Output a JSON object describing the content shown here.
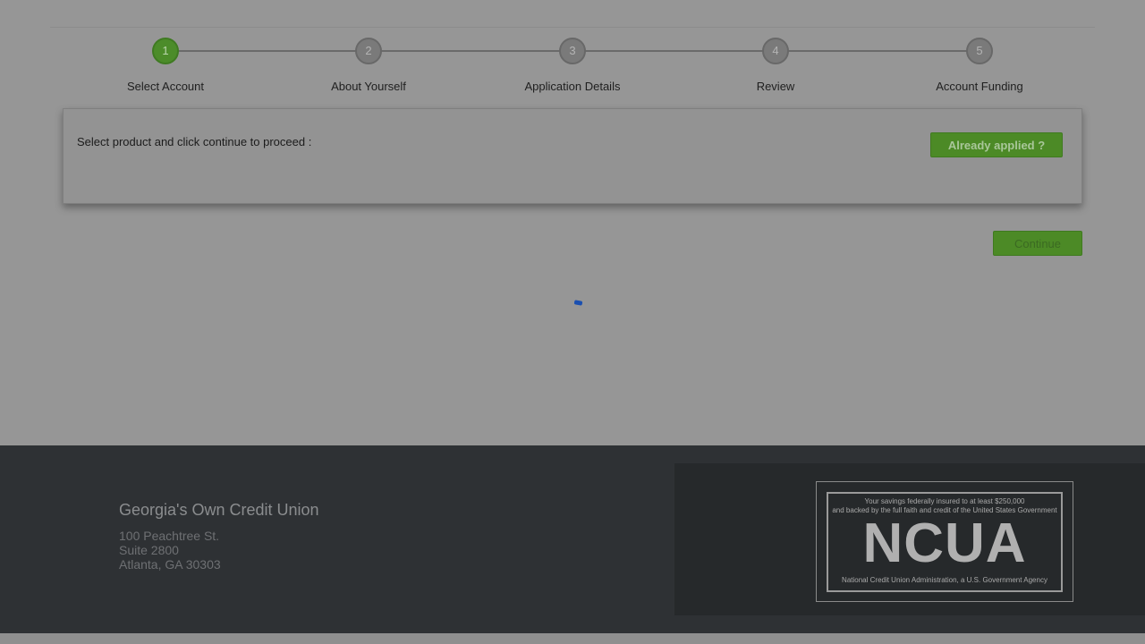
{
  "stepper": {
    "steps": [
      {
        "number": "1",
        "label": "Select Account",
        "active": true
      },
      {
        "number": "2",
        "label": "About Yourself",
        "active": false
      },
      {
        "number": "3",
        "label": "Application Details",
        "active": false
      },
      {
        "number": "4",
        "label": "Review",
        "active": false
      },
      {
        "number": "5",
        "label": "Account Funding",
        "active": false
      }
    ]
  },
  "panel": {
    "instruction": "Select product and click continue to proceed :",
    "already_applied_label": "Already applied ?"
  },
  "actions": {
    "continue_label": "Continue"
  },
  "footer": {
    "org_name": "Georgia's Own Credit Union",
    "address": [
      "100 Peachtree St.",
      "Suite 2800",
      "Atlanta, GA 30303"
    ],
    "seal": {
      "top_line_1": "Your savings federally insured to at least $250,000",
      "top_line_2": "and backed by the full faith and credit of the United States Government",
      "big_text": "NCUA",
      "bottom_line": "National Credit Union Administration, a U.S. Government Agency"
    }
  },
  "colors": {
    "accent_green": "#4c8a26",
    "overlay_gray": "#969696",
    "footer_dark": "#2e3134"
  }
}
